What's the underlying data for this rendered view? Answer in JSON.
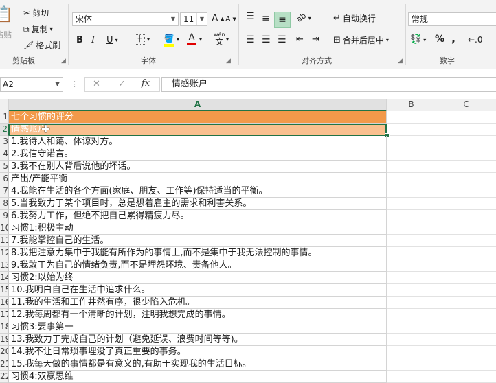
{
  "colors": {
    "accent": "#217346",
    "row1_fill": "#f2994a",
    "row2_fill": "#f9c08f",
    "header_fill": "#ffffff"
  },
  "ribbon": {
    "clipboard": {
      "label": "剪贴板",
      "paste": "粘贴",
      "cut": "剪切",
      "copy": "复制",
      "format_painter": "格式刷"
    },
    "font": {
      "label": "字体",
      "font_name": "宋体",
      "font_size": "11",
      "bold": "B",
      "italic": "I",
      "underline": "U",
      "grow": "A",
      "shrink": "A",
      "font_color_glyph": "A",
      "phonetic_top": "wén",
      "phonetic_bottom": "文"
    },
    "alignment": {
      "label": "对齐方式",
      "wrap_text": "自动换行",
      "merge_center": "合并后居中"
    },
    "number": {
      "label": "数字",
      "format": "常规",
      "percent": "%",
      "comma": ","
    }
  },
  "formula_bar": {
    "name_box": "A2",
    "fx": "fx",
    "cancel": "✕",
    "confirm": "✓",
    "value": "情感账户"
  },
  "sheet": {
    "columns": [
      "A",
      "B",
      "C"
    ],
    "rows": [
      {
        "n": "1",
        "a": "七个习惯的评分"
      },
      {
        "n": "2",
        "a": "情感账户"
      },
      {
        "n": "3",
        "a": "1.我待人和蔼、体谅对方。"
      },
      {
        "n": "4",
        "a": "2.我信守诺言。"
      },
      {
        "n": "5",
        "a": "3.我不在别人背后说他的坏话。"
      },
      {
        "n": "6",
        "a": "产出/产能平衡"
      },
      {
        "n": "7",
        "a": "4.我能在生活的各个方面(家庭、朋友、工作等)保持适当的平衡。"
      },
      {
        "n": "8",
        "a": "5.当我致力于某个项目时，总是想着雇主的需求和利害关系。"
      },
      {
        "n": "9",
        "a": "6.我努力工作，但绝不把自己累得精疲力尽。"
      },
      {
        "n": "10",
        "a": "习惯1:积极主动"
      },
      {
        "n": "11",
        "a": "7.我能掌控自己的生活。"
      },
      {
        "n": "12",
        "a": "8.我把注意力集中于我能有所作为的事情上,而不是集中于我无法控制的事情。"
      },
      {
        "n": "13",
        "a": "9.我敢于为自己的情绪负责,而不是埋怨环境、责备他人。"
      },
      {
        "n": "14",
        "a": "习惯2:以始为终"
      },
      {
        "n": "15",
        "a": "10.我明白自己在生活中追求什么。"
      },
      {
        "n": "16",
        "a": "11.我的生活和工作井然有序，很少陷入危机。"
      },
      {
        "n": "17",
        "a": "12.我每周都有一个清晰的计划，注明我想完成的事情。"
      },
      {
        "n": "18",
        "a": "习惯3:要事第一"
      },
      {
        "n": "19",
        "a": "13.我致力于完成自己的计划（避免延误、浪费时间等等)。"
      },
      {
        "n": "20",
        "a": "14.我不让日常琐事埋没了真正重要的事务。"
      },
      {
        "n": "21",
        "a": "15.我每天做的事情都是有意义的,有助于实现我的生活目标。"
      },
      {
        "n": "22",
        "a": "习惯4:双赢思维"
      }
    ]
  }
}
